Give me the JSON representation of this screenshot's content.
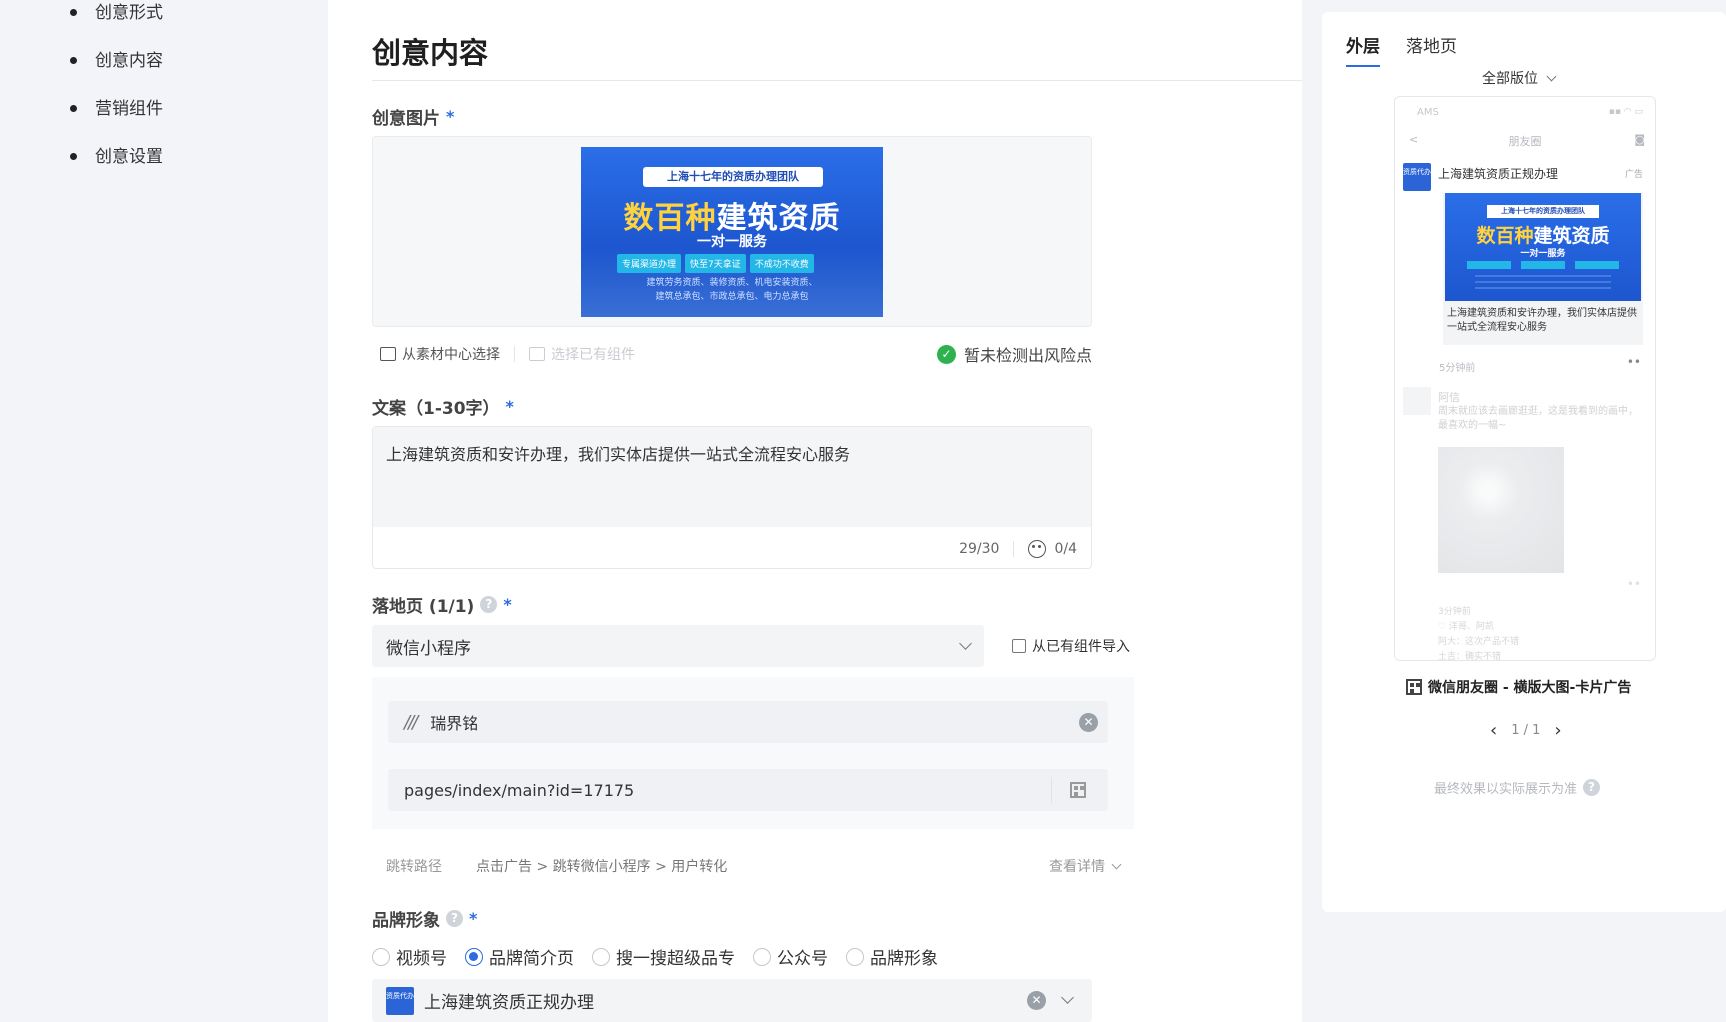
{
  "nav": {
    "items": [
      "创意形式",
      "创意内容",
      "营销组件",
      "创意设置"
    ]
  },
  "main": {
    "title": "创意内容",
    "image_section": {
      "label": "创意图片",
      "required": "*",
      "banner": {
        "tag": "上海十七年的资质办理团队",
        "headline_highlight": "数百种",
        "headline_rest": "建筑资质",
        "sub": "一对一服务",
        "pills": [
          "专属渠道办理",
          "快至7天拿证",
          "不成功不收费"
        ],
        "small_line1": "建筑劳务资质、装修资质、机电安装资质、",
        "small_line2": "建筑总承包、市政总承包、电力总承包"
      },
      "tool_from_library": "从素材中心选择",
      "tool_existing": "选择已有组件",
      "risk_text": "暂未检测出风险点"
    },
    "copy_section": {
      "label": "文案（1-30字）",
      "required": "*",
      "value": "上海建筑资质和安许办理，我们实体店提供一站式全流程安心服务",
      "counter": "29/30",
      "emoji_count": "0/4"
    },
    "landing_section": {
      "label": "落地页 (1/1)",
      "required": "*",
      "select_value": "微信小程序",
      "import_label": "从已有组件导入",
      "app_logo": "///",
      "app_name": "瑞界铭",
      "path_value": "pages/index/main?id=17175",
      "jump_label": "跳转路径",
      "jump_path": "点击广告 > 跳转微信小程序 > 用户转化",
      "details_label": "查看详情"
    },
    "brand_section": {
      "label": "品牌形象",
      "required": "*",
      "options": [
        "视频号",
        "品牌简介页",
        "搜一搜超级品专",
        "公众号",
        "品牌形象"
      ],
      "selected_index": 1,
      "selected_value": "上海建筑资质正规办理",
      "avatar_text": "资质代办"
    }
  },
  "preview": {
    "tabs": [
      "外层",
      "落地页"
    ],
    "active_tab": 0,
    "position_select": "全部版位",
    "phone": {
      "carrier": "AMS",
      "status_icons": "▪▪ ◠ ▭",
      "nav_back": "<",
      "nav_title": "朋友圈",
      "nav_camera": "◙",
      "ad_name": "上海建筑资质正规办理",
      "ad_flag": "广告",
      "ad_img_tag": "上海十七年的资质办理团队",
      "ad_img_highlight": "数百种",
      "ad_img_rest": "建筑资质",
      "ad_img_sub": "一对一服务",
      "ad_copy": "上海建筑资质和安许办理，我们实体店提供一站式全流程安心服务",
      "ad_time": "5分钟前",
      "more": "••",
      "friend_name": "阿信",
      "friend_text": "周末就应该去画廊逛逛，这是我看到的画中，最喜欢的一幅~",
      "friend_time": "3分钟前",
      "friend_likes": "♡ 洋哥、阿凯",
      "friend_comment1": "阿大：这次产品不错",
      "friend_comment2": "土吉：确实不错"
    },
    "ad_type": "微信朋友圈 - 横版大图-卡片广告",
    "pager_prev": "‹",
    "pager": "1 / 1",
    "pager_next": "›",
    "note": "最终效果以实际展示为准",
    "help_glyph": "?"
  },
  "colors": {
    "accent": "#2d6be0",
    "success": "#2fb14f",
    "banner_blue": "#1d56cf",
    "banner_highlight": "#ffd23e"
  }
}
